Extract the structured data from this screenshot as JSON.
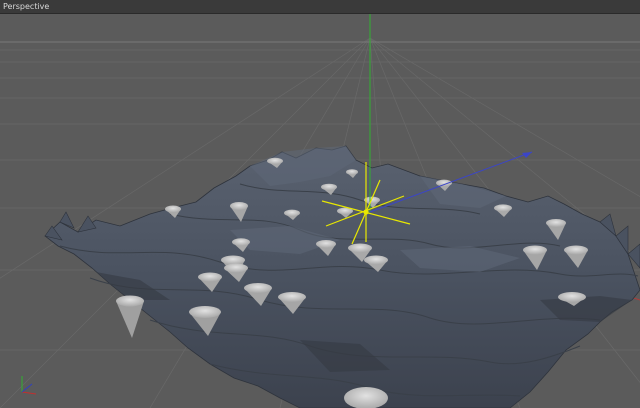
{
  "viewport": {
    "title": "Perspective",
    "view_type": "perspective",
    "background_color": "#5b5b5b",
    "grid_color": "#6a6a6a",
    "mesh_color": "#4a5260",
    "cone_color": "#c8c8c8",
    "axis_colors": {
      "x": "#c03030",
      "y": "#30b030",
      "z": "#3040c0"
    },
    "manipulator_color": "#e8e800"
  }
}
